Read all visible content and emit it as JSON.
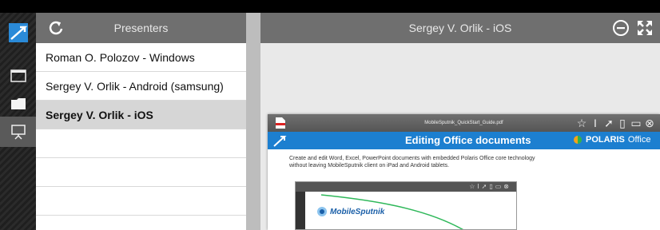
{
  "sidebar": {
    "items": [
      {
        "icon": "app-logo-icon"
      },
      {
        "icon": "window-icon"
      },
      {
        "icon": "folder-icon"
      },
      {
        "icon": "presentation-icon"
      }
    ]
  },
  "presenters": {
    "title": "Presenters",
    "items": [
      "Roman O. Polozov - Windows",
      "Sergey V. Orlik - Android (samsung)",
      "Sergey V. Orlik - iOS",
      "",
      "",
      ""
    ],
    "selected_index": 2
  },
  "viewer": {
    "title": "Sergey V. Orlik - iOS"
  },
  "document": {
    "filename": "MobileSputnik_QuickStart_Guide.pdf",
    "slide_title": "Editing Office documents",
    "brand_bold": "POLARIS",
    "brand_rest": "Office",
    "body_line1": "Create and edit Word, Excel, PowerPoint documents with embedded Polaris Office core technology",
    "body_line2": "without leaving MobileSputnik client on iPad and Android tablets.",
    "embed_logo": "MobileSputnik"
  },
  "colors": {
    "accent_blue": "#1c7fd0",
    "header_gray": "#6f6f6f"
  }
}
